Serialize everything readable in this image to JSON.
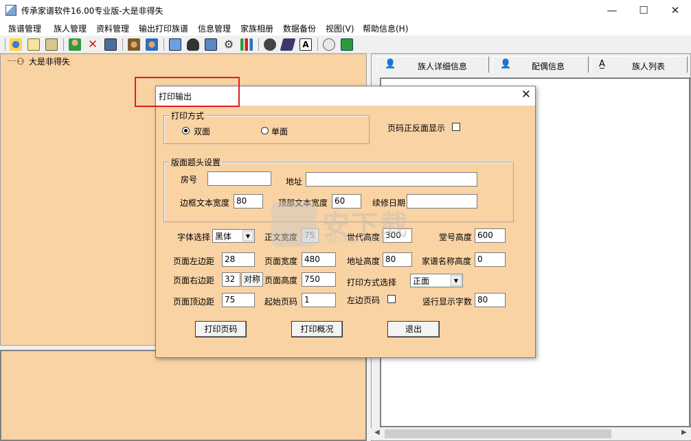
{
  "window": {
    "title": "传承家谱软件16.00专业版-大是非得失"
  },
  "menubar": {
    "items": [
      "族谱管理",
      "族人管理",
      "资料管理",
      "输出打印族谱",
      "信息管理",
      "家族相册",
      "数据备份",
      "视图(V)",
      "帮助信息(H)"
    ]
  },
  "tree": {
    "root_label": "大是非得失"
  },
  "tabs": [
    {
      "label": "族人详细信息",
      "icon": "person-icon"
    },
    {
      "label": "配偶信息",
      "icon": "spouse-icon"
    },
    {
      "label": "族人列表",
      "icon": "list-icon"
    }
  ],
  "dialog": {
    "title": "打印输出",
    "print_mode": {
      "group_title": "打印方式",
      "options": [
        {
          "label": "双面",
          "selected": true
        },
        {
          "label": "单面",
          "selected": false
        }
      ]
    },
    "page_num_both_sides": {
      "label": "页码正反面显示",
      "checked": false
    },
    "header": {
      "group_title": "版面题头设置",
      "room_label": "房号",
      "room_value": "",
      "address_label": "地址",
      "address_value": "",
      "border_width_label": "边框文本宽度",
      "border_width_value": "80",
      "top_width_label": "顶部文本宽度",
      "top_width_value": "60",
      "revise_date_label": "续修日期",
      "revise_date_value": ""
    },
    "font_label": "字体选择",
    "font_value": "黑体",
    "body_width_label": "正文宽度",
    "body_width_value": "75",
    "gen_height_label": "世代高度",
    "gen_height_value": "300",
    "hall_height_label": "堂号高度",
    "hall_height_value": "600",
    "left_margin_label": "页面左边距",
    "left_margin_value": "28",
    "page_width_label": "页面宽度",
    "page_width_value": "480",
    "addr_height_label": "地址高度",
    "addr_height_value": "80",
    "genealogy_name_height_label": "家谱名称高度",
    "genealogy_name_height_value": "0",
    "right_margin_label": "页面右边距",
    "right_margin_value": "32",
    "symmetric_button": "对称",
    "page_height_label": "页面高度",
    "page_height_value": "750",
    "print_select_label": "打印方式选择",
    "print_select_value": "正面",
    "top_margin_label": "页面顶边距",
    "top_margin_value": "75",
    "start_page_label": "起始页码",
    "start_page_value": "1",
    "left_page_num_label": "左边页码",
    "left_page_num_checked": false,
    "vertical_chars_label": "竖行显示字数",
    "vertical_chars_value": "80",
    "buttons": {
      "print_page": "打印页码",
      "print_overview": "打印概况",
      "exit": "退出"
    }
  },
  "watermark": {
    "text": "安下载",
    "sub": "anxz.com"
  },
  "colors": {
    "panel_bg": "#f9d3a4",
    "highlight": "#e21b1b"
  }
}
